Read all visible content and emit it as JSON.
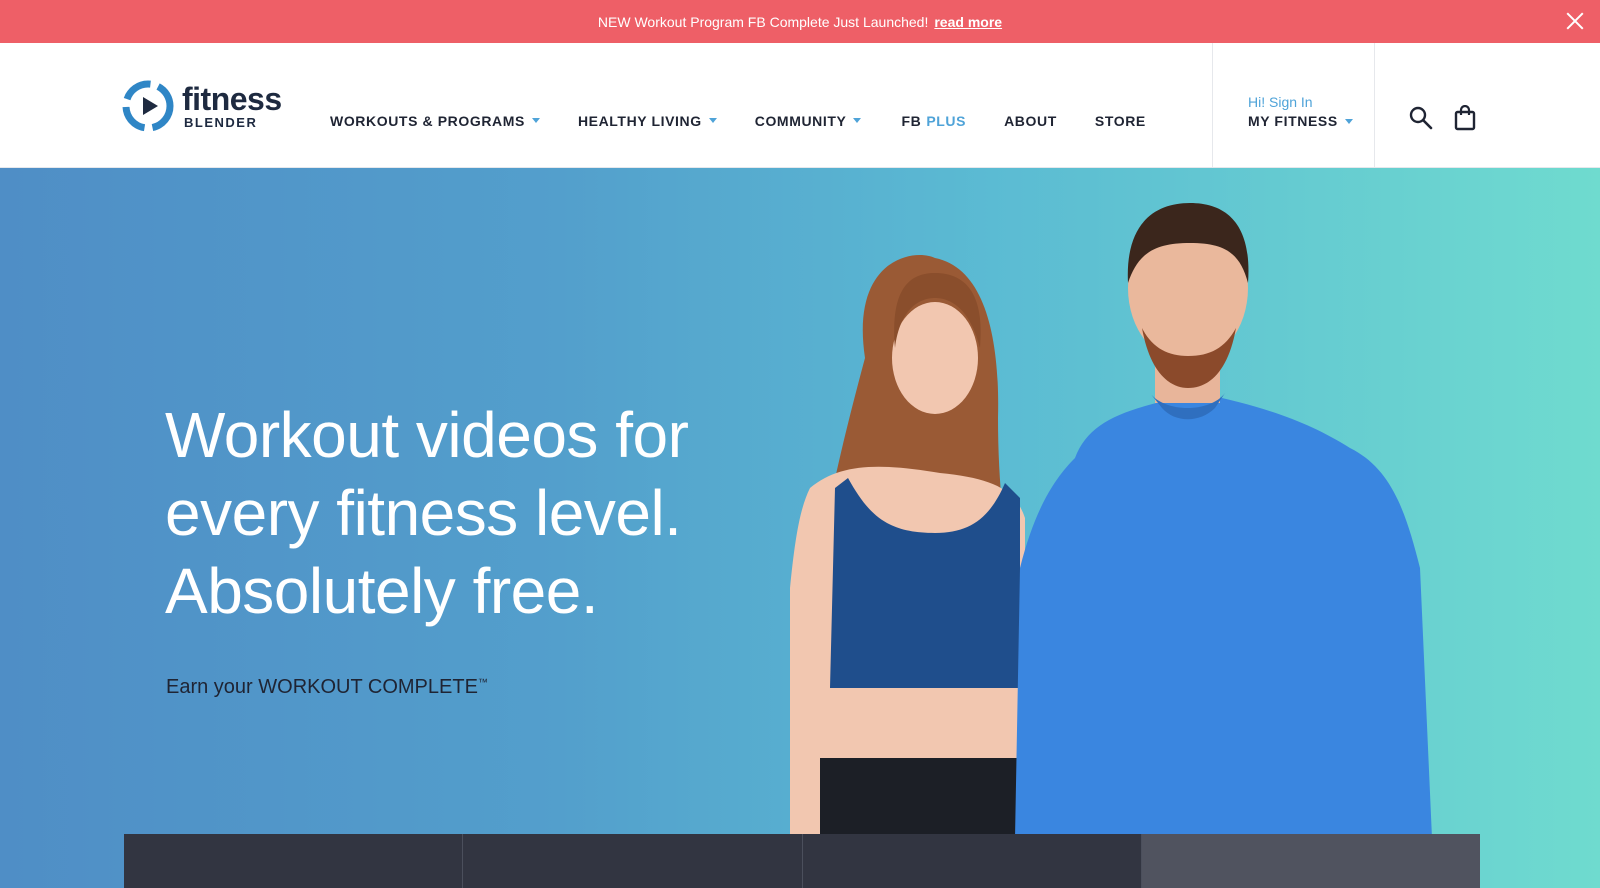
{
  "announcement": {
    "message": "NEW Workout Program FB Complete Just Launched!",
    "link": "read more",
    "close_icon": "close-icon"
  },
  "logo": {
    "word1": "fitness",
    "word2": "BLENDER"
  },
  "nav": {
    "items": [
      {
        "label": "WORKOUTS & PROGRAMS",
        "dropdown": true
      },
      {
        "label": "HEALTHY LIVING",
        "dropdown": true
      },
      {
        "label": "COMMUNITY",
        "dropdown": true
      },
      {
        "label": "FB",
        "suffix": "PLUS",
        "dropdown": false
      },
      {
        "label": "ABOUT",
        "dropdown": false
      },
      {
        "label": "STORE",
        "dropdown": false
      }
    ]
  },
  "account": {
    "greeting": "Hi! Sign In",
    "menu": "MY FITNESS"
  },
  "tools": {
    "search_icon": "search-icon",
    "cart_icon": "shopping-bag-icon"
  },
  "hero": {
    "headline": "Workout videos for every fitness level. Absolutely free.",
    "subline": "Earn your WORKOUT COMPLETE",
    "trademark": "™"
  },
  "colors": {
    "announcement_bg": "#ee5f67",
    "accent": "#4fa3d8",
    "hero_gradient_start": "#4f8ec6",
    "hero_gradient_end": "#6fdbcf",
    "tile_dark": "#323541"
  }
}
